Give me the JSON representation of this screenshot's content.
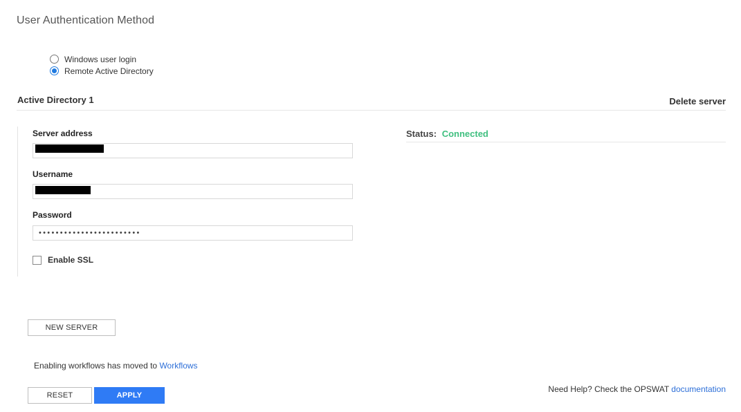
{
  "page": {
    "title": "User Authentication Method"
  },
  "auth_methods": {
    "options": [
      {
        "label": "Windows user login",
        "checked": false
      },
      {
        "label": "Remote Active Directory",
        "checked": true
      }
    ]
  },
  "server": {
    "title": "Active Directory 1",
    "delete_label": "Delete server",
    "address_label": "Server address",
    "address_value": "",
    "username_label": "Username",
    "username_value": "",
    "password_label": "Password",
    "password_mask": "••••••••••••••••••••••••",
    "ssl_label": "Enable SSL",
    "ssl_checked": false,
    "status_label": "Status:",
    "status_value": "Connected"
  },
  "actions": {
    "new_server": "NEW SERVER",
    "reset": "RESET",
    "apply": "APPLY"
  },
  "notes": {
    "workflows_prefix": "Enabling workflows has moved to ",
    "workflows_link": "Workflows",
    "help_prefix": "Need Help? Check the OPSWAT ",
    "help_link": "documentation"
  },
  "colors": {
    "accent": "#2f7bf5",
    "status_connected": "#3fbf7f",
    "link": "#2d6fd8"
  }
}
